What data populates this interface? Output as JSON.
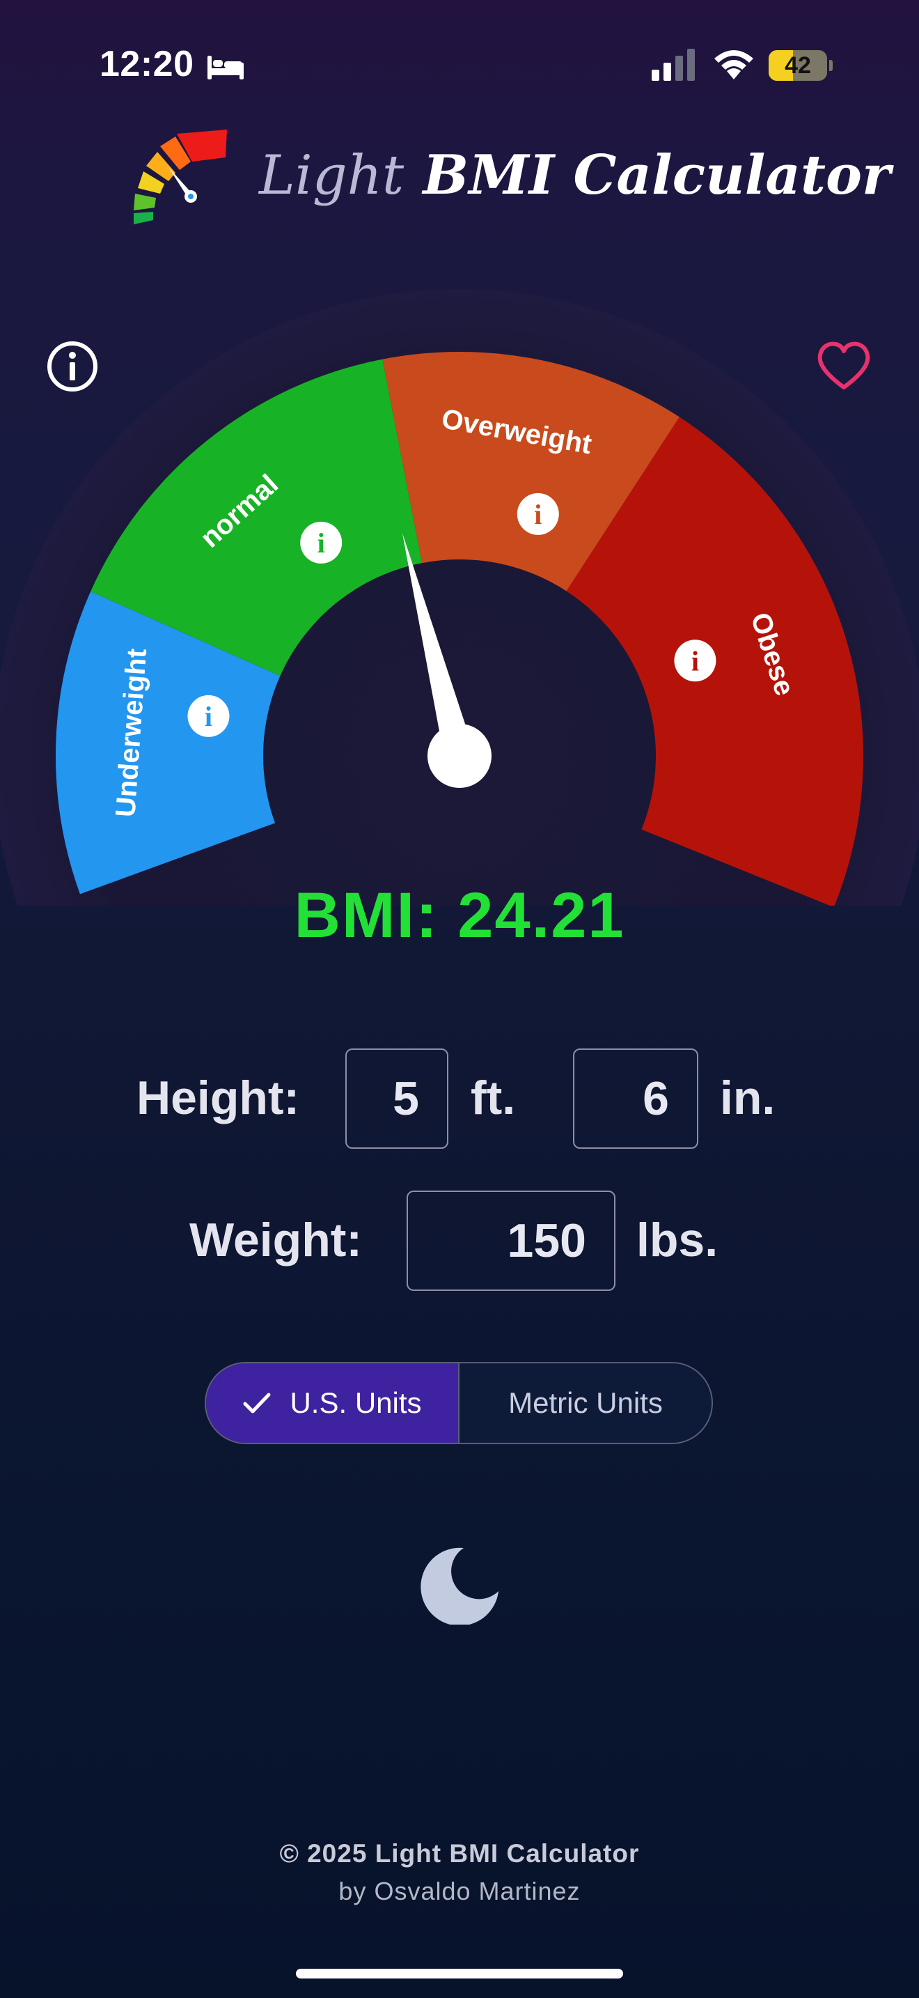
{
  "status_bar": {
    "time": "12:20",
    "battery": "42",
    "battery_level": 0.42,
    "icons": [
      "bed-icon",
      "signal-icon",
      "wifi-icon",
      "battery-icon"
    ]
  },
  "header": {
    "title_light": "Light",
    "title_main": "BMI Calculator",
    "logo_icon": "gauge-logo-icon"
  },
  "gauge": {
    "segments": [
      {
        "label": "Underweight",
        "color": "#2396f0"
      },
      {
        "label": "normal",
        "color": "#18b226"
      },
      {
        "label": "Overweight",
        "color": "#c94a1c"
      },
      {
        "label": "Obese",
        "color": "#b5130a"
      }
    ],
    "info_icon": "i",
    "needle_value": 24.21
  },
  "bmi": {
    "text": "BMI: 24.21",
    "color": "#22e036"
  },
  "form": {
    "height_label": "Height:",
    "feet_value": "5",
    "feet_unit": "ft.",
    "inches_value": "6",
    "inches_unit": "in.",
    "weight_label": "Weight:",
    "weight_value": "150",
    "weight_unit": "lbs."
  },
  "units": {
    "us": "U.S. Units",
    "metric": "Metric Units",
    "selected": "us"
  },
  "theme": {
    "toggle_icon": "moon-icon"
  },
  "footer": {
    "line1": "© 2025 Light BMI Calculator",
    "line2": "by Osvaldo Martinez"
  },
  "colors": {
    "accent": "#3f22a0",
    "heart": "#e8326e"
  }
}
